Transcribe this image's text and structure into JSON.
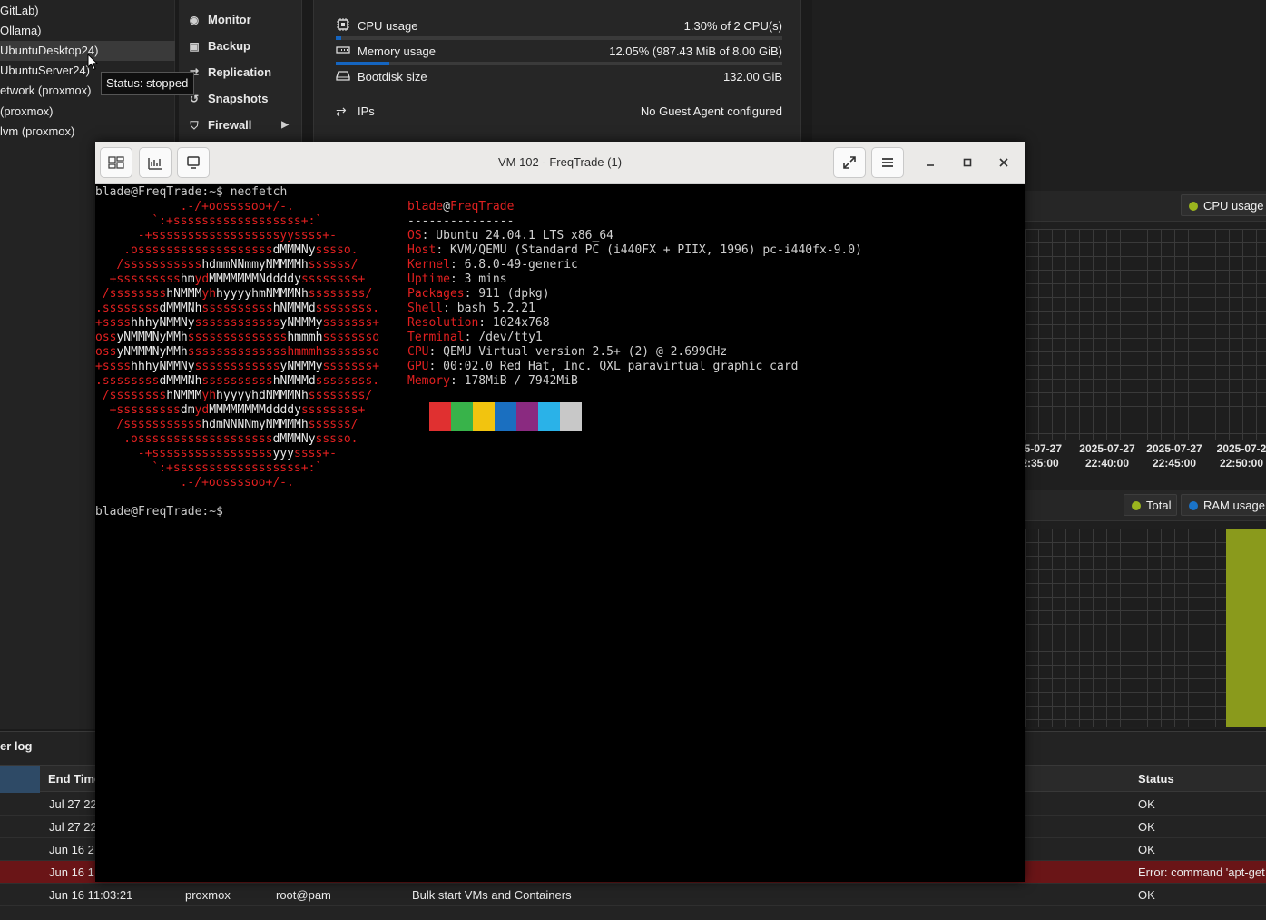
{
  "tree": {
    "items": [
      {
        "label": "GitLab)",
        "selected": false
      },
      {
        "label": "Ollama)",
        "selected": false
      },
      {
        "label": "UbuntuDesktop24)",
        "selected": true
      },
      {
        "label": "UbuntuServer24)",
        "selected": false
      },
      {
        "label": "etwork (proxmox)",
        "selected": false
      },
      {
        "label": "(proxmox)",
        "selected": false
      },
      {
        "label": "lvm (proxmox)",
        "selected": false
      }
    ],
    "tooltip": "Status: stopped"
  },
  "vm_menu": {
    "items": [
      {
        "label": "Monitor",
        "icon": "eye-icon"
      },
      {
        "label": "Backup",
        "icon": "floppy-icon"
      },
      {
        "label": "Replication",
        "icon": "retweet-icon"
      },
      {
        "label": "Snapshots",
        "icon": "history-icon"
      },
      {
        "label": "Firewall",
        "icon": "shield-icon"
      }
    ]
  },
  "summary": {
    "cpu": {
      "label": "CPU usage",
      "value": "1.30% of 2 CPU(s)",
      "fraction": 0.013
    },
    "memory": {
      "label": "Memory usage",
      "value": "12.05% (987.43 MiB of 8.00 GiB)",
      "fraction": 0.1205
    },
    "bootdisk": {
      "label": "Bootdisk size",
      "value": "132.00 GiB"
    },
    "ips": {
      "label": "IPs",
      "value": "No Guest Agent configured"
    }
  },
  "cpu_chart": {
    "legend": [
      {
        "label": "CPU usage",
        "color": "#9bb51e"
      }
    ],
    "ticks": [
      {
        "date": "25-07-27",
        "time": "2:35:00"
      },
      {
        "date": "2025-07-27",
        "time": "22:40:00"
      },
      {
        "date": "2025-07-27",
        "time": "22:45:00"
      },
      {
        "date": "2025-07-2",
        "time": "22:50:00"
      }
    ]
  },
  "ram_chart": {
    "legend": [
      {
        "label": "Total",
        "color": "#9bb51e"
      },
      {
        "label": "RAM usage",
        "color": "#1a73c8"
      }
    ]
  },
  "task_log": {
    "title": "er log",
    "columns": {
      "end_time": "End Time",
      "status": "Status"
    },
    "rows": [
      {
        "end_time": "Jul 27 22",
        "node": "",
        "user": "",
        "description": "",
        "status": "OK",
        "error": false
      },
      {
        "end_time": "Jul 27 22",
        "node": "",
        "user": "",
        "description": "",
        "status": "OK",
        "error": false
      },
      {
        "end_time": "Jun 16 2",
        "node": "",
        "user": "",
        "description": "",
        "status": "OK",
        "error": false
      },
      {
        "end_time": "Jun 16 1",
        "node": "",
        "user": "",
        "description": "",
        "status": "Error: command 'apt-get",
        "error": true
      },
      {
        "end_time": "Jun 16 11:03:21",
        "node": "proxmox",
        "user": "root@pam",
        "description": "Bulk start VMs and Containers",
        "status": "OK",
        "error": false
      }
    ]
  },
  "console": {
    "title": "VM 102 - FreqTrade (1)",
    "prompt_cmd": "blade@FreqTrade:~$ neofetch",
    "prompt_end": "blade@FreqTrade:~$",
    "user": "blade",
    "at": "@",
    "host": "FreqTrade",
    "separator": "---------------",
    "info": [
      {
        "key": "OS",
        "value": ": Ubuntu 24.04.1 LTS x86_64"
      },
      {
        "key": "Host",
        "value": ": KVM/QEMU (Standard PC (i440FX + PIIX, 1996) pc-i440fx-9.0)"
      },
      {
        "key": "Kernel",
        "value": ": 6.8.0-49-generic"
      },
      {
        "key": "Uptime",
        "value": ": 3 mins"
      },
      {
        "key": "Packages",
        "value": ": 911 (dpkg)"
      },
      {
        "key": "Shell",
        "value": ": bash 5.2.21"
      },
      {
        "key": "Resolution",
        "value": ": 1024x768"
      },
      {
        "key": "Terminal",
        "value": ": /dev/tty1"
      },
      {
        "key": "CPU",
        "value": ": QEMU Virtual version 2.5+ (2) @ 2.699GHz"
      },
      {
        "key": "GPU",
        "value": ": 00:02.0 Red Hat, Inc. QXL paravirtual graphic card"
      },
      {
        "key": "Memory",
        "value": ": 178MiB / 7942MiB"
      }
    ],
    "swatches": [
      "#e03030",
      "#38b34a",
      "#f2c40f",
      "#1a6fc0",
      "#8a2a80",
      "#2ab2e8",
      "#c8c8c8"
    ],
    "ascii_art": [
      {
        "indent": 12,
        "segments": [
          {
            "t": ".-/+oossssoo+/-.",
            "w": false
          }
        ]
      },
      {
        "indent": 8,
        "segments": [
          {
            "t": "`:+ssssssssssssssssss+:`",
            "w": false
          }
        ]
      },
      {
        "indent": 6,
        "segments": [
          {
            "t": "-+ssssssssssssssssssyyssss+-",
            "w": false
          }
        ]
      },
      {
        "indent": 4,
        "segments": [
          {
            "t": ".osssssssssssssssssss",
            "w": false
          },
          {
            "t": "dMMMNy",
            "w": true
          },
          {
            "t": "sssso.",
            "w": false
          }
        ]
      },
      {
        "indent": 3,
        "segments": [
          {
            "t": "/sssssssssss",
            "w": false
          },
          {
            "t": "hdmmNNmmyNMMMMh",
            "w": true
          },
          {
            "t": "ssssss/",
            "w": false
          }
        ]
      },
      {
        "indent": 2,
        "segments": [
          {
            "t": "+sssssssss",
            "w": false
          },
          {
            "t": "hm",
            "w": true
          },
          {
            "t": "yd",
            "w": false
          },
          {
            "t": "MMMMMMMNddddy",
            "w": true
          },
          {
            "t": "ssssssss+",
            "w": false
          }
        ]
      },
      {
        "indent": 1,
        "segments": [
          {
            "t": "/ssssssss",
            "w": false
          },
          {
            "t": "hNMMM",
            "w": true
          },
          {
            "t": "yh",
            "w": false
          },
          {
            "t": "hyyyyhmNMMMNh",
            "w": true
          },
          {
            "t": "ssssssss/",
            "w": false
          }
        ]
      },
      {
        "indent": 0,
        "segments": [
          {
            "t": ".ssssssss",
            "w": false
          },
          {
            "t": "dMMMNh",
            "w": true
          },
          {
            "t": "ssssssssss",
            "w": false
          },
          {
            "t": "hNMMMd",
            "w": true
          },
          {
            "t": "ssssssss.",
            "w": false
          }
        ]
      },
      {
        "indent": 0,
        "segments": [
          {
            "t": "+ssss",
            "w": false
          },
          {
            "t": "hhhyNMMNy",
            "w": true
          },
          {
            "t": "ssssssssssss",
            "w": false
          },
          {
            "t": "yNMMMy",
            "w": true
          },
          {
            "t": "sssssss+",
            "w": false
          }
        ]
      },
      {
        "indent": 0,
        "segments": [
          {
            "t": "oss",
            "w": false
          },
          {
            "t": "yNMMMNyMMh",
            "w": true
          },
          {
            "t": "ssssssssssssss",
            "w": false
          },
          {
            "t": "hmmmh",
            "w": true
          },
          {
            "t": "ssssssso",
            "w": false
          }
        ]
      },
      {
        "indent": 0,
        "segments": [
          {
            "t": "oss",
            "w": false
          },
          {
            "t": "yNMMMNyMMh",
            "w": true
          },
          {
            "t": "sssssssssssssshmmmhssssssso",
            "w": false
          }
        ]
      },
      {
        "indent": 0,
        "segments": [
          {
            "t": "+ssss",
            "w": false
          },
          {
            "t": "hhhyNMMNy",
            "w": true
          },
          {
            "t": "ssssssssssss",
            "w": false
          },
          {
            "t": "yNMMMy",
            "w": true
          },
          {
            "t": "sssssss+",
            "w": false
          }
        ]
      },
      {
        "indent": 0,
        "segments": [
          {
            "t": ".ssssssss",
            "w": false
          },
          {
            "t": "dMMMNh",
            "w": true
          },
          {
            "t": "ssssssssss",
            "w": false
          },
          {
            "t": "hNMMMd",
            "w": true
          },
          {
            "t": "ssssssss.",
            "w": false
          }
        ]
      },
      {
        "indent": 1,
        "segments": [
          {
            "t": "/ssssssss",
            "w": false
          },
          {
            "t": "hNMMM",
            "w": true
          },
          {
            "t": "yh",
            "w": false
          },
          {
            "t": "hyyyyhdNMMMNh",
            "w": true
          },
          {
            "t": "ssssssss/",
            "w": false
          }
        ]
      },
      {
        "indent": 2,
        "segments": [
          {
            "t": "+sssssssss",
            "w": false
          },
          {
            "t": "dm",
            "w": true
          },
          {
            "t": "yd",
            "w": false
          },
          {
            "t": "MMMMMMMMddddy",
            "w": true
          },
          {
            "t": "ssssssss+",
            "w": false
          }
        ]
      },
      {
        "indent": 3,
        "segments": [
          {
            "t": "/sssssssssss",
            "w": false
          },
          {
            "t": "hdmNNNNmyNMMMMh",
            "w": true
          },
          {
            "t": "ssssss/",
            "w": false
          }
        ]
      },
      {
        "indent": 4,
        "segments": [
          {
            "t": ".osssssssssssssssssss",
            "w": false
          },
          {
            "t": "dMMMNy",
            "w": true
          },
          {
            "t": "sssso.",
            "w": false
          }
        ]
      },
      {
        "indent": 6,
        "segments": [
          {
            "t": "-+sssssssssssssssss",
            "w": false
          },
          {
            "t": "yyy",
            "w": true
          },
          {
            "t": "ssss+-",
            "w": false
          }
        ]
      },
      {
        "indent": 8,
        "segments": [
          {
            "t": "`:+ssssssssssssssssss+:`",
            "w": false
          }
        ]
      },
      {
        "indent": 12,
        "segments": [
          {
            "t": ".-/+oossssoo+/-.",
            "w": false
          }
        ]
      }
    ]
  }
}
